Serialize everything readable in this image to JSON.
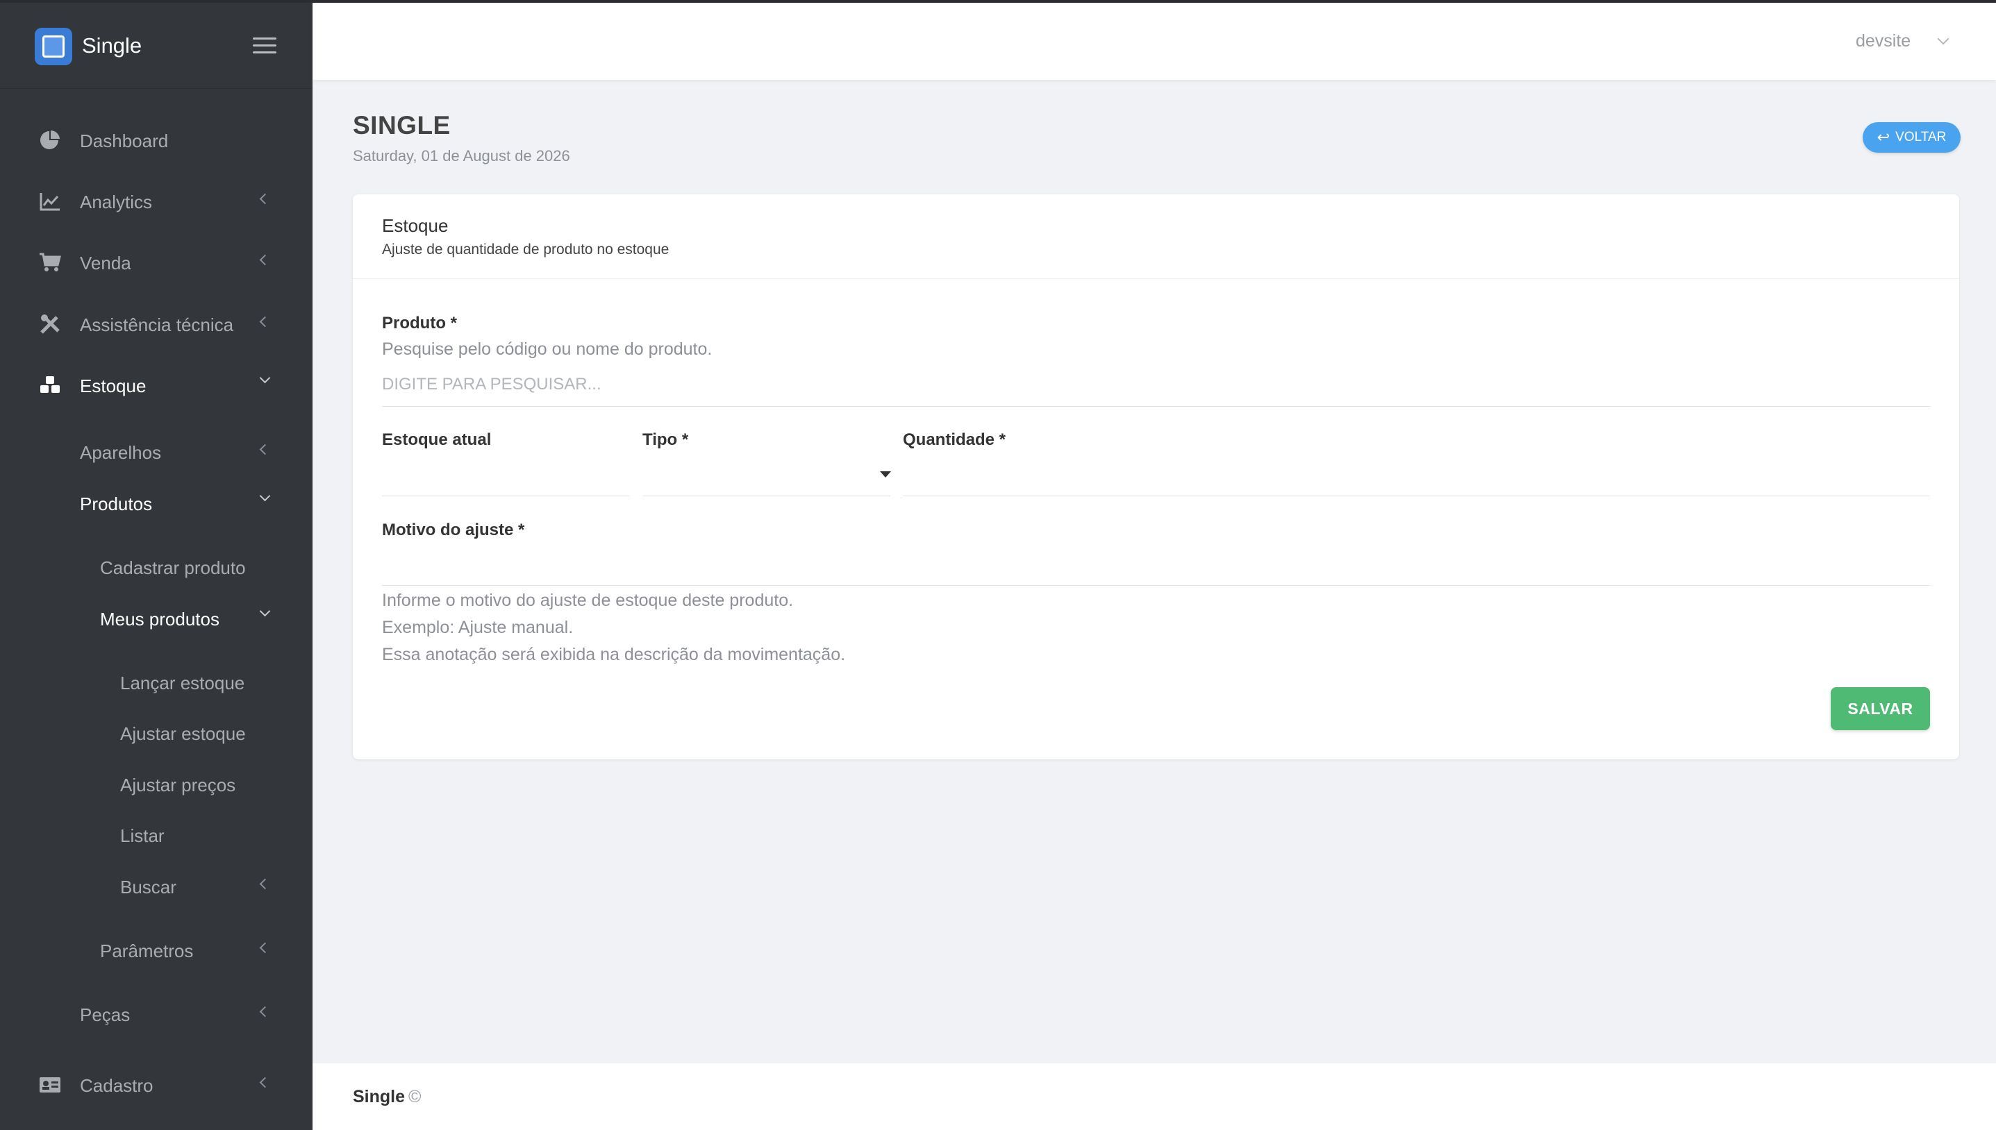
{
  "app": {
    "name": "Single"
  },
  "header": {
    "user": "devsite"
  },
  "sidebar": {
    "items": [
      {
        "label": "Dashboard",
        "icon": "pie-chart-icon"
      },
      {
        "label": "Analytics",
        "icon": "line-chart-icon"
      },
      {
        "label": "Venda",
        "icon": "cart-icon"
      },
      {
        "label": "Assistência técnica",
        "icon": "tools-icon"
      },
      {
        "label": "Estoque",
        "icon": "boxes-icon"
      },
      {
        "label": "Aparelhos"
      },
      {
        "label": "Produtos"
      },
      {
        "label": "Cadastrar produto"
      },
      {
        "label": "Meus produtos"
      },
      {
        "label": "Lançar estoque"
      },
      {
        "label": "Ajustar estoque"
      },
      {
        "label": "Ajustar preços"
      },
      {
        "label": "Listar"
      },
      {
        "label": "Buscar"
      },
      {
        "label": "Parâmetros"
      },
      {
        "label": "Peças"
      },
      {
        "label": "Cadastro",
        "icon": "id-card-icon"
      }
    ]
  },
  "page": {
    "title": "SINGLE",
    "date": "Saturday, 01 de August de 2026",
    "back_label": "VOLTAR"
  },
  "card": {
    "title": "Estoque",
    "subtitle": "Ajuste de quantidade de produto no estoque",
    "produto_label": "Produto *",
    "produto_help": "Pesquise pelo código ou nome do produto.",
    "produto_placeholder": "DIGITE PARA PESQUISAR...",
    "estoque_label": "Estoque atual",
    "tipo_label": "Tipo *",
    "quantidade_label": "Quantidade *",
    "motivo_label": "Motivo do ajuste *",
    "motivo_help": [
      "Informe o motivo do ajuste de estoque deste produto.",
      "Exemplo: Ajuste manual.",
      "Essa anotação será exibida na descrição da movimentação."
    ],
    "save_label": "SALVAR"
  },
  "footer": {
    "brand": "Single",
    "copy": "©"
  },
  "colors": {
    "sidebar": "#33363b",
    "accent": "#4aa3ef",
    "save": "#4fba74"
  }
}
